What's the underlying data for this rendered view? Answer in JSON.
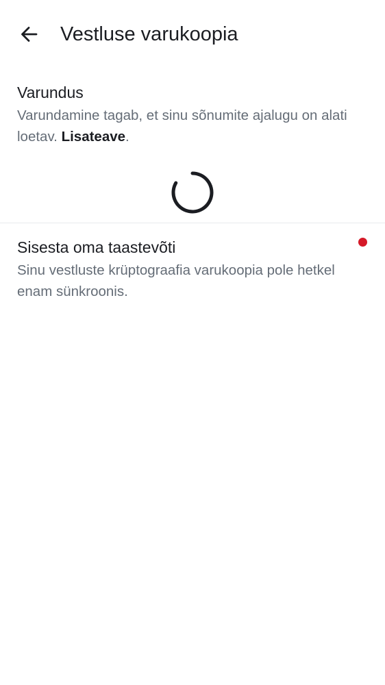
{
  "header": {
    "back_icon": "arrow-left-icon",
    "title": "Vestluse varukoopia"
  },
  "backup": {
    "title": "Varundus",
    "description_before": "Varundamine tagab, et sinu sõnumite ajalugu on alati loetav. ",
    "link_label": "Lisateave",
    "description_after": ".",
    "status_icon": "loading-spinner-icon"
  },
  "recovery": {
    "title": "Sisesta oma taastevõti",
    "description": "Sinu vestluste krüptograafia varukoopia pole hetkel enam sünkroonis.",
    "alert_icon": "red-dot-indicator",
    "alert_color": "#d51928"
  },
  "colors": {
    "text_primary": "#1b1d22",
    "text_secondary": "#656d77",
    "divider": "#e8eaed",
    "background": "#ffffff"
  }
}
